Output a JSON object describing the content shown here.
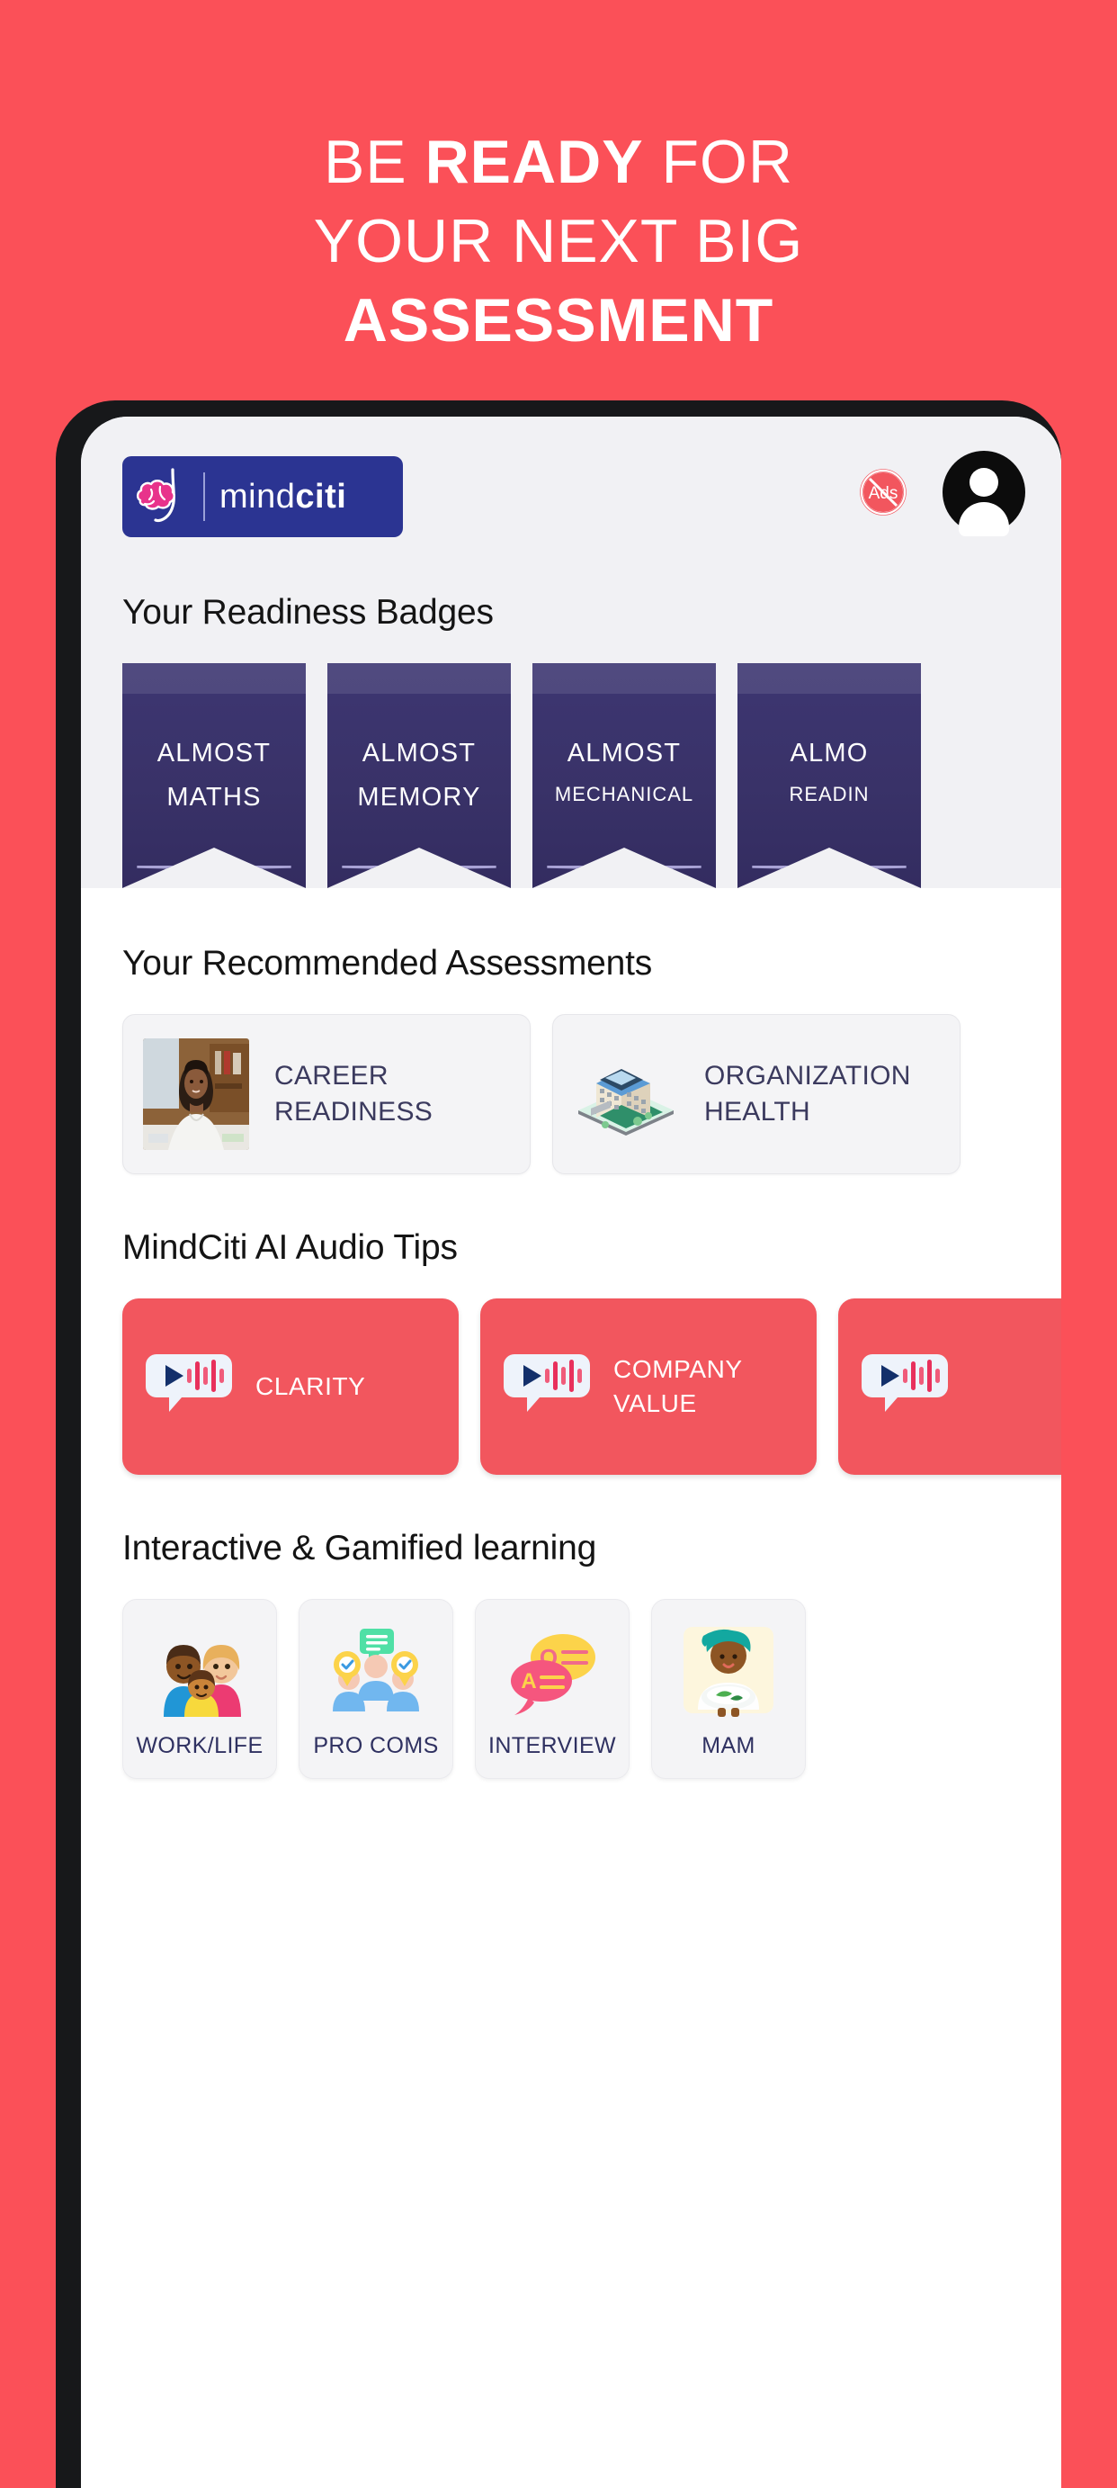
{
  "promo": {
    "headline_line1_a": "BE ",
    "headline_line1_b": "READY",
    "headline_line1_c": " FOR",
    "headline_line2": "YOUR NEXT BIG",
    "headline_line3": "ASSESSMENT"
  },
  "colors": {
    "background": "#fb5058",
    "accent_coral": "#f2565e",
    "brand_navy": "#2b3492",
    "badge_purple": "#3d3672",
    "label_ink": "#2f3161"
  },
  "app": {
    "logo": {
      "name": "mindciti",
      "text_light": "mind",
      "text_bold": "citi",
      "mark": "brain-logo-icon"
    },
    "header_icons": {
      "no_ads": "no-ads-icon",
      "no_ads_text": "Ads",
      "avatar": "user-avatar-icon"
    },
    "sections": {
      "badges": {
        "title": "Your Readiness Badges",
        "items": [
          {
            "status": "ALMOST",
            "label": "MATHS",
            "small": false
          },
          {
            "status": "ALMOST",
            "label": "MEMORY",
            "small": false
          },
          {
            "status": "ALMOST",
            "label": "MECHANICAL",
            "small": true
          },
          {
            "status": "ALMO",
            "label": "READIN",
            "small": true
          }
        ]
      },
      "assessments": {
        "title": "Your Recommended Assessments",
        "items": [
          {
            "label_line1": "CAREER",
            "label_line2": "READINESS",
            "art": "woman-at-desk-photo"
          },
          {
            "label_line1": "ORGANIZATION",
            "label_line2": "HEALTH",
            "art": "office-building-icon"
          }
        ]
      },
      "audio_tips": {
        "title": "MindCiti AI Audio Tips",
        "icon": "audio-play-waveform-icon",
        "items": [
          {
            "label_line1": "CLARITY",
            "label_line2": ""
          },
          {
            "label_line1": "COMPANY",
            "label_line2": "VALUE"
          },
          {
            "label_line1": "",
            "label_line2": ""
          }
        ]
      },
      "learning": {
        "title": "Interactive & Gamified learning",
        "items": [
          {
            "label": "WORK/LIFE",
            "art": "family-icon"
          },
          {
            "label": "PRO COMS",
            "art": "team-chat-icon"
          },
          {
            "label": "INTERVIEW",
            "art": "qa-speech-bubbles-icon"
          },
          {
            "label": "MAM",
            "art": "meal-person-icon"
          }
        ]
      }
    }
  }
}
